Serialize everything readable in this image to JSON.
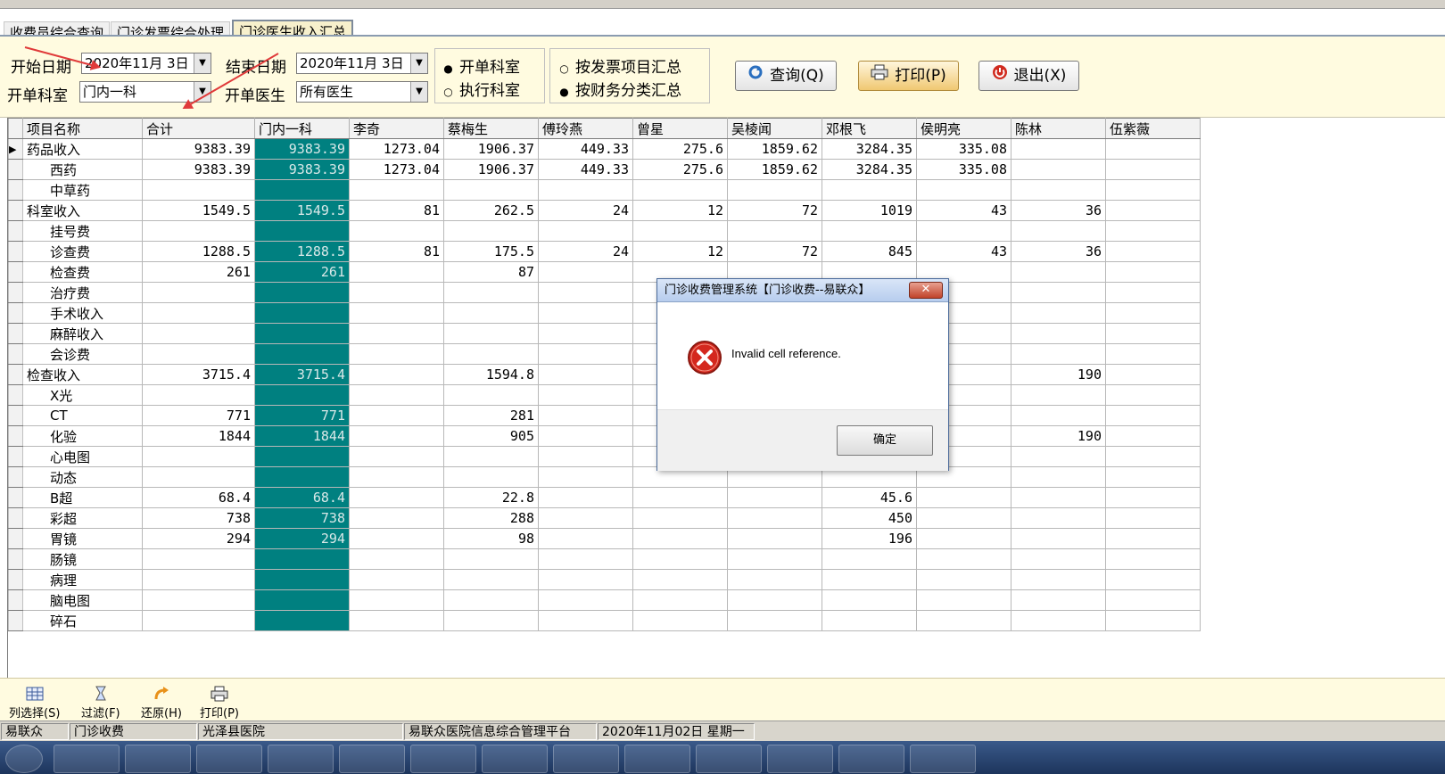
{
  "tabs": [
    {
      "label": "收费员综合查询",
      "active": false
    },
    {
      "label": "门诊发票综合处理",
      "active": false
    },
    {
      "label": "门诊医生收入汇总",
      "active": true
    }
  ],
  "filters": {
    "start_date_label": "开始日期",
    "start_date_value": "2020年11月 3日",
    "end_date_label": "结束日期",
    "end_date_value": "2020年11月 3日",
    "dept_label": "开单科室",
    "dept_value": "门内一科",
    "doctor_label": "开单医生",
    "doctor_value": "所有医生",
    "dept_type_options": [
      {
        "label": "开单科室",
        "selected": true
      },
      {
        "label": "执行科室",
        "selected": false
      }
    ],
    "summary_options": [
      {
        "label": "按发票项目汇总",
        "selected": false
      },
      {
        "label": "按财务分类汇总",
        "selected": true
      }
    ],
    "query_label": "查询(Q)",
    "print_label": "打印(P)",
    "exit_label": "退出(X)"
  },
  "grid": {
    "headers": [
      "项目名称",
      "合计",
      "门内一科",
      "李奇",
      "蔡梅生",
      "傅玲燕",
      "曾星",
      "吴棱闻",
      "邓根飞",
      "侯明亮",
      "陈林",
      "伍紫薇"
    ],
    "rows": [
      {
        "name": "药品收入",
        "sub": false,
        "current": true,
        "cells": [
          "9383.39",
          "9383.39",
          "1273.04",
          "1906.37",
          "449.33",
          "275.6",
          "1859.62",
          "3284.35",
          "335.08",
          "",
          ""
        ]
      },
      {
        "name": "西药",
        "sub": true,
        "cells": [
          "9383.39",
          "9383.39",
          "1273.04",
          "1906.37",
          "449.33",
          "275.6",
          "1859.62",
          "3284.35",
          "335.08",
          "",
          ""
        ]
      },
      {
        "name": "中草药",
        "sub": true,
        "cells": [
          "",
          "",
          "",
          "",
          "",
          "",
          "",
          "",
          "",
          "",
          ""
        ]
      },
      {
        "name": "科室收入",
        "sub": false,
        "cells": [
          "1549.5",
          "1549.5",
          "81",
          "262.5",
          "24",
          "12",
          "72",
          "1019",
          "43",
          "36",
          ""
        ]
      },
      {
        "name": "挂号费",
        "sub": true,
        "cells": [
          "",
          "",
          "",
          "",
          "",
          "",
          "",
          "",
          "",
          "",
          ""
        ]
      },
      {
        "name": "诊查费",
        "sub": true,
        "cells": [
          "1288.5",
          "1288.5",
          "81",
          "175.5",
          "24",
          "12",
          "72",
          "845",
          "43",
          "36",
          ""
        ]
      },
      {
        "name": "检查费",
        "sub": true,
        "cells": [
          "261",
          "261",
          "",
          "87",
          "",
          "",
          "",
          "",
          "",
          "",
          ""
        ]
      },
      {
        "name": "治疗费",
        "sub": true,
        "cells": [
          "",
          "",
          "",
          "",
          "",
          "",
          "",
          "",
          "",
          "",
          ""
        ]
      },
      {
        "name": "手术收入",
        "sub": true,
        "cells": [
          "",
          "",
          "",
          "",
          "",
          "",
          "",
          "",
          "",
          "",
          ""
        ]
      },
      {
        "name": "麻醉收入",
        "sub": true,
        "cells": [
          "",
          "",
          "",
          "",
          "",
          "",
          "",
          "",
          "",
          "",
          ""
        ]
      },
      {
        "name": "会诊费",
        "sub": true,
        "cells": [
          "",
          "",
          "",
          "",
          "",
          "",
          "",
          "",
          "",
          "",
          ""
        ]
      },
      {
        "name": "检查收入",
        "sub": false,
        "cells": [
          "3715.4",
          "3715.4",
          "",
          "1594.8",
          "",
          "",
          "",
          "",
          "",
          "190",
          ""
        ]
      },
      {
        "name": "X光",
        "sub": true,
        "cells": [
          "",
          "",
          "",
          "",
          "",
          "",
          "",
          "",
          "",
          "",
          ""
        ]
      },
      {
        "name": "CT",
        "sub": true,
        "cells": [
          "771",
          "771",
          "",
          "281",
          "",
          "",
          "",
          "",
          "",
          "",
          ""
        ]
      },
      {
        "name": "化验",
        "sub": true,
        "cells": [
          "1844",
          "1844",
          "",
          "905",
          "",
          "",
          "",
          "",
          "",
          "190",
          ""
        ]
      },
      {
        "name": "心电图",
        "sub": true,
        "cells": [
          "",
          "",
          "",
          "",
          "",
          "",
          "",
          "",
          "",
          "",
          ""
        ]
      },
      {
        "name": "动态",
        "sub": true,
        "cells": [
          "",
          "",
          "",
          "",
          "",
          "",
          "",
          "",
          "",
          "",
          ""
        ]
      },
      {
        "name": "B超",
        "sub": true,
        "cells": [
          "68.4",
          "68.4",
          "",
          "22.8",
          "",
          "",
          "",
          "45.6",
          "",
          "",
          ""
        ]
      },
      {
        "name": "彩超",
        "sub": true,
        "cells": [
          "738",
          "738",
          "",
          "288",
          "",
          "",
          "",
          "450",
          "",
          "",
          ""
        ]
      },
      {
        "name": "胃镜",
        "sub": true,
        "cells": [
          "294",
          "294",
          "",
          "98",
          "",
          "",
          "",
          "196",
          "",
          "",
          ""
        ]
      },
      {
        "name": "肠镜",
        "sub": true,
        "cells": [
          "",
          "",
          "",
          "",
          "",
          "",
          "",
          "",
          "",
          "",
          ""
        ]
      },
      {
        "name": "病理",
        "sub": true,
        "cells": [
          "",
          "",
          "",
          "",
          "",
          "",
          "",
          "",
          "",
          "",
          ""
        ]
      },
      {
        "name": "脑电图",
        "sub": true,
        "cells": [
          "",
          "",
          "",
          "",
          "",
          "",
          "",
          "",
          "",
          "",
          ""
        ]
      },
      {
        "name": "碎石",
        "sub": true,
        "cells": [
          "",
          "",
          "",
          "",
          "",
          "",
          "",
          "",
          "",
          "",
          ""
        ]
      }
    ]
  },
  "bottom_tools": [
    {
      "label": "列选择(S)",
      "icon": "column-select-icon"
    },
    {
      "label": "过滤(F)",
      "icon": "filter-icon"
    },
    {
      "label": "还原(H)",
      "icon": "restore-icon"
    },
    {
      "label": "打印(P)",
      "icon": "printer-icon"
    }
  ],
  "status": {
    "company": "易联众",
    "module": "门诊收费",
    "hospital": "光泽县医院",
    "platform": "易联众医院信息综合管理平台",
    "date": "2020年11月02日 星期一"
  },
  "dialog": {
    "title": "门诊收费管理系统【门诊收费--易联众】",
    "close": "✕",
    "message": "Invalid cell reference.",
    "ok_label": "确定"
  },
  "colors": {
    "highlight_column": "#008080",
    "panel_background": "#fffbe0",
    "arrow": "#e03a3a"
  }
}
